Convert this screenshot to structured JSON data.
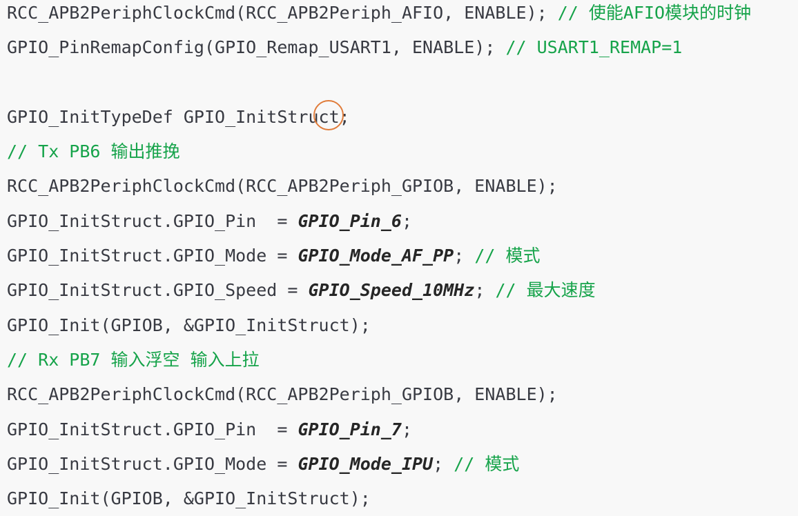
{
  "lines": [
    [
      {
        "t": "RCC_APB2PeriphClockCmd(RCC_APB2Periph_AFIO, ENABLE); "
      },
      {
        "t": "// 使能AFIO模块的时钟",
        "s": "cm"
      }
    ],
    [
      {
        "t": "GPIO_PinRemapConfig(GPIO_Remap_USART1, ENABLE); "
      },
      {
        "t": "// USART1_REMAP=1",
        "s": "cm"
      }
    ],
    [],
    [
      {
        "t": "GPIO_InitTypeDef GPIO_InitStruct;"
      }
    ],
    [
      {
        "t": "// Tx PB6 输出推挽",
        "s": "cm"
      }
    ],
    [
      {
        "t": "RCC_APB2PeriphClockCmd(RCC_APB2Periph_GPIOB, ENABLE);"
      }
    ],
    [
      {
        "t": "GPIO_InitStruct.GPIO_Pin  = "
      },
      {
        "t": "GPIO_Pin_6",
        "s": "em"
      },
      {
        "t": ";"
      }
    ],
    [
      {
        "t": "GPIO_InitStruct.GPIO_Mode = "
      },
      {
        "t": "GPIO_Mode_AF_PP",
        "s": "em"
      },
      {
        "t": "; "
      },
      {
        "t": "// 模式",
        "s": "cm"
      }
    ],
    [
      {
        "t": "GPIO_InitStruct.GPIO_Speed = "
      },
      {
        "t": "GPIO_Speed_10MHz",
        "s": "em"
      },
      {
        "t": "; "
      },
      {
        "t": "// 最大速度",
        "s": "cm"
      }
    ],
    [
      {
        "t": "GPIO_Init(GPIOB, &GPIO_InitStruct);"
      }
    ],
    [
      {
        "t": "// Rx PB7 输入浮空 输入上拉",
        "s": "cm"
      }
    ],
    [
      {
        "t": "RCC_APB2PeriphClockCmd(RCC_APB2Periph_GPIOB, ENABLE);"
      }
    ],
    [
      {
        "t": "GPIO_InitStruct.GPIO_Pin  = "
      },
      {
        "t": "GPIO_Pin_7",
        "s": "em"
      },
      {
        "t": ";"
      }
    ],
    [
      {
        "t": "GPIO_InitStruct.GPIO_Mode = "
      },
      {
        "t": "GPIO_Mode_IPU",
        "s": "em"
      },
      {
        "t": "; "
      },
      {
        "t": "// 模式",
        "s": "cm"
      }
    ],
    [
      {
        "t": "GPIO_Init(GPIOB, &GPIO_InitStruct);"
      }
    ]
  ],
  "colors": {
    "background": "#f8f8f8",
    "code_text": "#383a42",
    "comment": "#16a34a",
    "cursor_ring": "#e07b39"
  },
  "icons": {
    "cursor": "mouse-cursor-highlight-ring"
  }
}
